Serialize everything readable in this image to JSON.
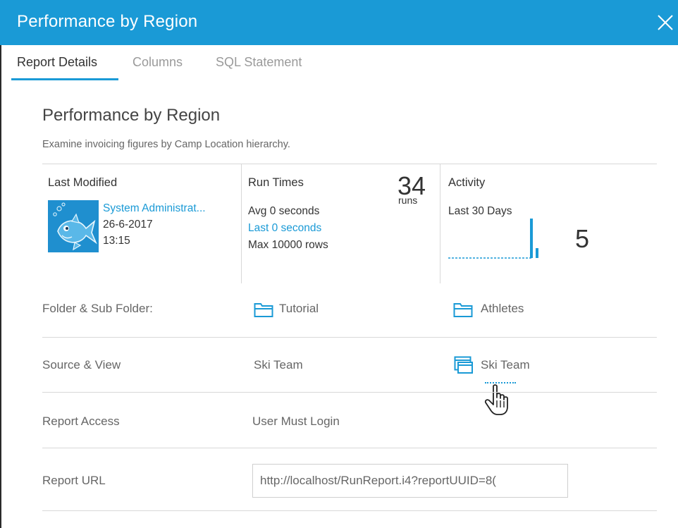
{
  "window": {
    "title": "Performance by Region",
    "close_icon": "close-icon"
  },
  "tabs": [
    {
      "label": "Report Details",
      "active": true
    },
    {
      "label": "Columns",
      "active": false
    },
    {
      "label": "SQL Statement",
      "active": false
    }
  ],
  "report": {
    "name": "Performance by Region",
    "description": "Examine invoicing figures by Camp Location hierarchy."
  },
  "last_modified": {
    "label": "Last Modified",
    "user": "System Administrat...",
    "date": "26-6-2017",
    "time": "13:15"
  },
  "run_times": {
    "label": "Run Times",
    "avg": "Avg  0 seconds",
    "last": "Last 0 seconds",
    "max": "Max 10000 rows",
    "runs_count": "34",
    "runs_label": "runs"
  },
  "activity": {
    "label": "Activity",
    "period": "Last 30 Days",
    "count": "5",
    "bar_values": [
      4,
      1
    ],
    "accent": "#1a9ad6"
  },
  "details": {
    "folder": {
      "label": "Folder & Sub Folder:",
      "folder": "Tutorial",
      "sub_folder": "Athletes"
    },
    "source": {
      "label": "Source & View",
      "source": "Ski Team",
      "view": "Ski Team"
    },
    "access": {
      "label": "Report Access",
      "value": "User Must Login"
    },
    "url": {
      "label": "Report URL",
      "value": "http://localhost/RunReport.i4?reportUUID=8("
    }
  },
  "colors": {
    "accent": "#1a9ad6",
    "title_bar": "#1a9ad6"
  }
}
